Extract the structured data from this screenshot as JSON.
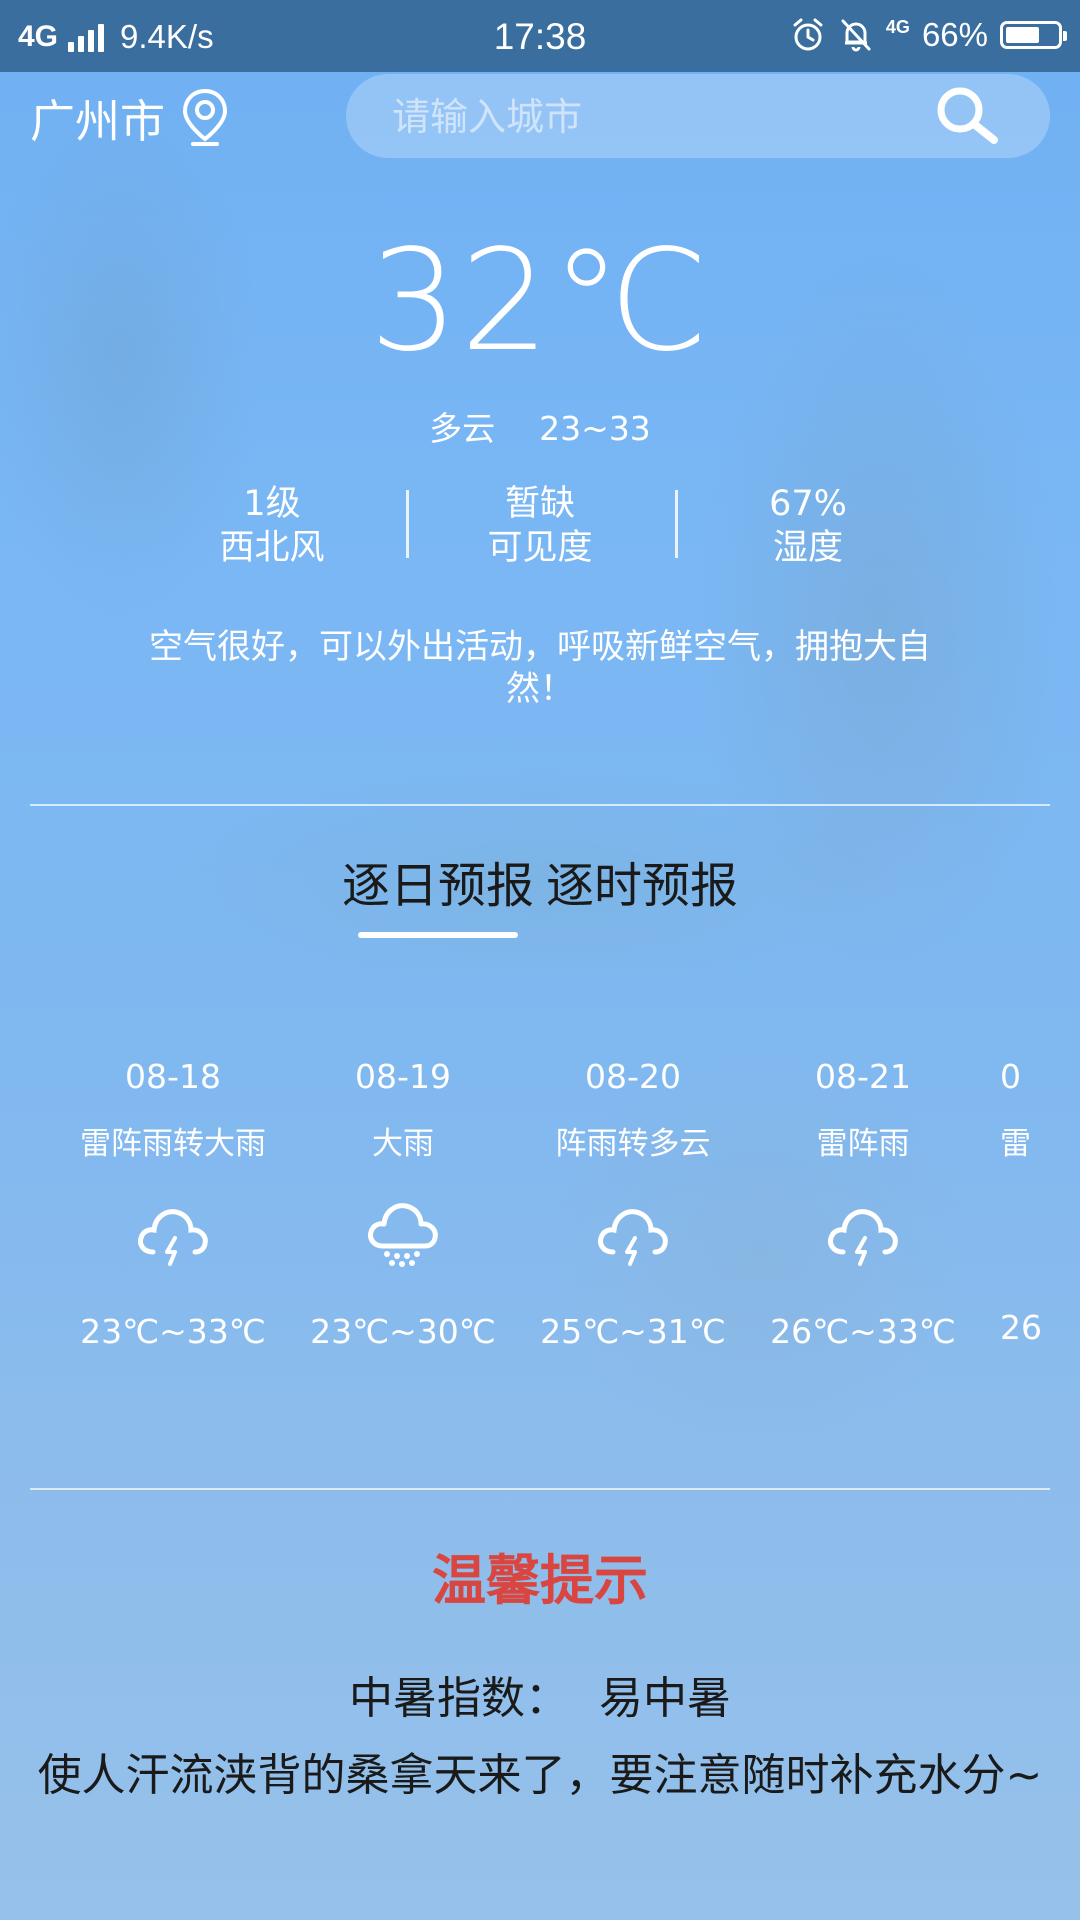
{
  "status_bar": {
    "network": "4G",
    "speed": "9.4K/s",
    "time": "17:38",
    "network_small": "4G",
    "battery": "66%",
    "battery_level": 0.66
  },
  "location": {
    "city": "广州市"
  },
  "search": {
    "placeholder": "请输入城市"
  },
  "current": {
    "temperature": "32℃",
    "condition": "多云",
    "range": "23~33",
    "stats": [
      {
        "value": "1级",
        "label": "西北风"
      },
      {
        "value": "暂缺",
        "label": "可见度"
      },
      {
        "value": "67%",
        "label": "湿度"
      }
    ],
    "advice": "空气很好，可以外出活动，呼吸新鲜空气，拥抱大自然！"
  },
  "tabs": [
    {
      "label": "逐日预报",
      "active": true
    },
    {
      "label": "逐时预报",
      "active": false
    }
  ],
  "forecast": [
    {
      "date": "08-18",
      "condition": "雷阵雨转大雨",
      "icon": "thunderstorm-icon",
      "range": "23℃~33℃"
    },
    {
      "date": "08-19",
      "condition": "大雨",
      "icon": "heavy-rain-icon",
      "range": "23℃~30℃"
    },
    {
      "date": "08-20",
      "condition": "阵雨转多云",
      "icon": "thunderstorm-icon",
      "range": "25℃~31℃"
    },
    {
      "date": "08-21",
      "condition": "雷阵雨",
      "icon": "thunderstorm-icon",
      "range": "26℃~33℃"
    },
    {
      "date": "0",
      "condition": "雷",
      "icon": "thunderstorm-icon",
      "range": "26"
    }
  ],
  "tips": {
    "title": "温馨提示",
    "index_label": "中暑指数：",
    "index_value": "易中暑",
    "text": "使人汗流浃背的桑拿天来了，要注意随时补充水分~"
  },
  "colors": {
    "status_bar": "#3a6e9e",
    "tip_title": "#d9453f"
  }
}
